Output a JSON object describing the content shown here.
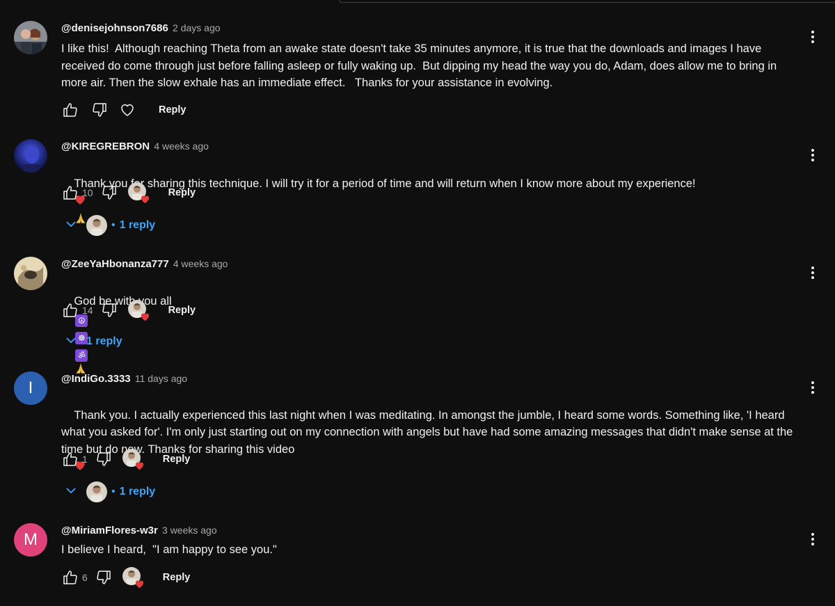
{
  "comments": [
    {
      "author": "@denisejohnson7686",
      "time": "2 days ago",
      "text": "I like this!  Although reaching Theta from an awake state doesn't take 35 minutes anymore, it is true that the downloads and images I have received do come through just before falling asleep or fully waking up.  But dipping my head the way you do, Adam, does allow me to bring in more air. Then the slow exhale has an immediate effect.   Thanks for your assistance in evolving.",
      "reply_label": "Reply"
    },
    {
      "author": "@KIREGREBRON",
      "time": "4 weeks ago",
      "text": "Thank you for sharing this technique. I will try it for a period of time and will return when I know more about my experience!",
      "likes": "10",
      "reply_label": "Reply",
      "replies_label": "1 reply"
    },
    {
      "author": "@ZeeYaHbonanza777",
      "time": "4 weeks ago",
      "text": "God be with you all",
      "likes": "14",
      "reply_label": "Reply",
      "replies_label": "1 reply"
    },
    {
      "author": "@IndiGo.3333",
      "time": "11 days ago",
      "avatar_letter": "I",
      "avatar_color": "#2b5fb0",
      "text": "Thank you. I actually experienced this last night when I was meditating. In amongst the jumble, I heard some words. Something like, 'I heard what you asked for'. I'm only just starting out on my connection with angels but have had some amazing messages that didn't make sense at the time but do now. Thanks for sharing this video",
      "likes": "1",
      "reply_label": "Reply",
      "replies_label": "1 reply"
    },
    {
      "author": "@MiriamFlores-w3r",
      "time": "3 weeks ago",
      "avatar_letter": "M",
      "avatar_color": "#e0427a",
      "text": "I believe I heard,  \"I am happy to see you.\"",
      "likes": "6",
      "reply_label": "Reply"
    }
  ],
  "icons": {
    "like": "thumbs-up-icon",
    "dislike": "thumbs-down-icon",
    "heart": "heart-icon",
    "more": "more-vert-icon",
    "expand": "chevron-down-icon",
    "emoji_heart": "red-heart-emoji",
    "emoji_pray": "folded-hands-emoji",
    "emoji_peace": "peace-symbol-emoji",
    "emoji_wheel": "wheel-of-dharma-emoji",
    "emoji_om": "om-emoji"
  },
  "colors": {
    "background": "#0f0f0f",
    "link_blue": "#3ea6ff",
    "heart_red": "#e33b3b",
    "secondary_text": "#aaaaaa"
  }
}
